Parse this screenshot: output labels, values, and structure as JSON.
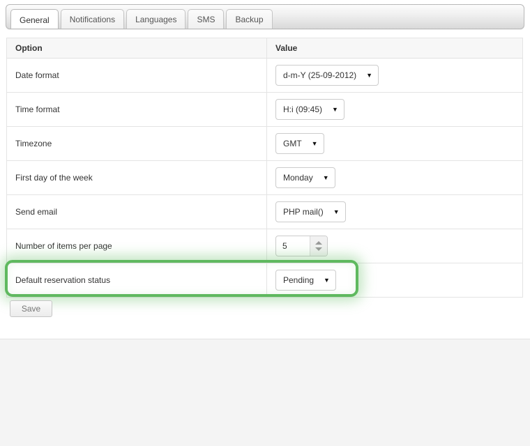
{
  "tabs": [
    {
      "label": "General",
      "active": true
    },
    {
      "label": "Notifications",
      "active": false
    },
    {
      "label": "Languages",
      "active": false
    },
    {
      "label": "SMS",
      "active": false
    },
    {
      "label": "Backup",
      "active": false
    }
  ],
  "table": {
    "headers": {
      "option": "Option",
      "value": "Value"
    },
    "rows": [
      {
        "option": "Date format",
        "control": "select",
        "value": "d-m-Y (25-09-2012)"
      },
      {
        "option": "Time format",
        "control": "select",
        "value": "H:i (09:45)"
      },
      {
        "option": "Timezone",
        "control": "select",
        "value": "GMT"
      },
      {
        "option": "First day of the week",
        "control": "select",
        "value": "Monday"
      },
      {
        "option": "Send email",
        "control": "select",
        "value": "PHP mail()"
      },
      {
        "option": "Number of items per page",
        "control": "number",
        "value": "5"
      },
      {
        "option": "Default reservation status",
        "control": "select",
        "value": "Pending"
      }
    ]
  },
  "buttons": {
    "save": "Save"
  },
  "icons": {
    "caret": "▼"
  },
  "colors": {
    "highlight": "#5fb95f",
    "page_background": "#f4f4f4",
    "header_background": "#f7f7f7"
  }
}
